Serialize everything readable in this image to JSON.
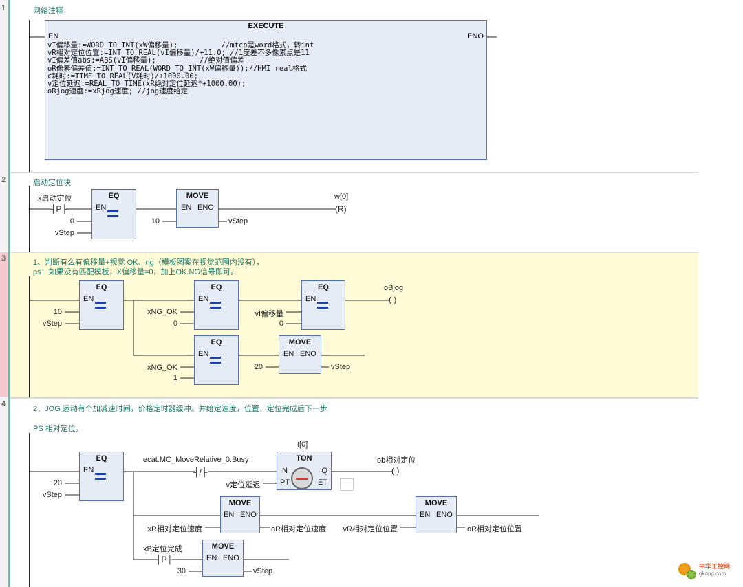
{
  "networks": {
    "n1": {
      "number": "1",
      "comment": "网络注释",
      "execute_title": "EXECUTE",
      "en": "EN",
      "eno": "ENO",
      "code": "vI偏移量:=WORD_TO_INT(xW偏移量);          //mtcp是word格式，转int\nvR相对定位位置:=INT_TO_REAL(vI偏移量)/+11.0; //1度差不多像素点是11\nvI偏差值abs:=ABS(vI偏移量);          //绝对值偏差\noR像素偏差值:=INT_TO_REAL(WORD_TO_INT(xW偏移量));//HMI real格式\nc耗时:=TIME_TO_REAL(V耗时)/+1000.00;\nv定位延迟:=REAL_TO_TIME(xR绝对定位延迟*+1000.00);\noRjog速度:=xRjog速度; //jog速度给定"
    },
    "n2": {
      "number": "2",
      "comment": "启动定位块",
      "contact_label": "x启动定位",
      "contact_symbol": "P",
      "eq_title": "EQ",
      "eq_en": "EN",
      "eq_in2": "0",
      "eq_in3": "vStep",
      "move_title": "MOVE",
      "move_en": "EN",
      "move_eno": "ENO",
      "move_in": "10",
      "move_out": "vStep",
      "coil_label": "w[0]",
      "coil_symbol": "R"
    },
    "n3": {
      "number": "3",
      "comment_line1": "1、判断有么有偏移量+视觉 OK、ng（模板图案在视觉范围内没有），",
      "comment_line2": "ps：如果没有匹配模板，X偏移量=0，加上OK.NG信号即可。",
      "eq1": {
        "title": "EQ",
        "en": "EN",
        "in1": "10",
        "in2": "vStep"
      },
      "eq2": {
        "title": "EQ",
        "en": "EN",
        "in1": "xNG_OK",
        "in2": "0"
      },
      "eq3": {
        "title": "EQ",
        "en": "EN",
        "in1": "vI偏移量",
        "in2": "0"
      },
      "eq4": {
        "title": "EQ",
        "en": "EN",
        "in1": "xNG_OK",
        "in2": "1"
      },
      "move": {
        "title": "MOVE",
        "en": "EN",
        "eno": "ENO",
        "in": "20",
        "out": "vStep"
      },
      "coil_label": "oBjog"
    },
    "n4": {
      "number": "4",
      "comment_line1": "2、JOG 运动有个加减速时间，价格定时器缓冲。并给定速度，位置，定位完成后下一步",
      "comment_line2": "PS 相对定位。",
      "eq": {
        "title": "EQ",
        "en": "EN",
        "in1": "20",
        "in2": "vStep"
      },
      "contact_label": "ecat.MC_MoveRelative_0.Busy",
      "contact_symbol": "/",
      "timer_label": "t[0]",
      "ton": {
        "title": "TON",
        "in": "IN",
        "pt": "PT",
        "q": "Q",
        "et": "ET",
        "pt_var": "v定位延迟"
      },
      "coil_label": "ob相对定位",
      "move1": {
        "title": "MOVE",
        "en": "EN",
        "eno": "ENO",
        "in": "xR相对定位速度",
        "out": "oR相对定位速度"
      },
      "move2": {
        "title": "MOVE",
        "en": "EN",
        "eno": "ENO",
        "in": "vR相对定位位置",
        "out": "oR相对定位位置"
      },
      "contact2_label": "xB定位完成",
      "contact2_symbol": "P",
      "move3": {
        "title": "MOVE",
        "en": "EN",
        "eno": "ENO",
        "in": "30",
        "out": "vStep"
      }
    }
  },
  "watermark": {
    "line1": "中华工控网",
    "line2": "gkong.com"
  },
  "colors": {
    "comment": "#1f7a6a",
    "block_fill": "#e6ecf6",
    "block_border": "#5470a8",
    "highlight": "#fffbd6",
    "eq_symbol": "#1a3fae"
  }
}
